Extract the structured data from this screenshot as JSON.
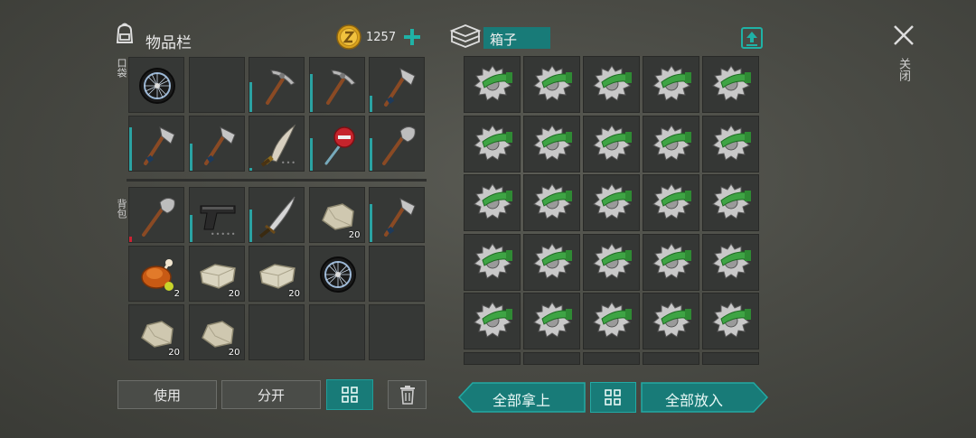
{
  "inventory": {
    "title": "物品栏",
    "coins": "1257",
    "pocket_label": "口袋",
    "backpack_label": "背包",
    "pocket_items": [
      {
        "icon": "wheel-icon"
      },
      {
        "icon": "empty"
      },
      {
        "icon": "pickaxe-icon",
        "durability": 0.55
      },
      {
        "icon": "pickaxe-icon",
        "durability": 0.7
      },
      {
        "icon": "hatchet-icon",
        "durability": 0.3
      },
      {
        "icon": "hatchet-icon",
        "durability": 0.8
      },
      {
        "icon": "hatchet-icon",
        "durability": 0.5
      },
      {
        "icon": "machete-icon",
        "durability": 0.0,
        "dots": "•••"
      },
      {
        "icon": "stop-sign-icon",
        "durability": 0.6
      },
      {
        "icon": "shovel-icon",
        "durability": 0.6
      }
    ],
    "backpack_items": [
      {
        "icon": "shovel-icon",
        "durability": 0.1,
        "red": true
      },
      {
        "icon": "pistol-icon",
        "durability": 0.5,
        "dots": "•••••"
      },
      {
        "icon": "sword-icon",
        "durability": 0.6
      },
      {
        "icon": "stone-icon",
        "count": "20"
      },
      {
        "icon": "hatchet-icon",
        "durability": 0.7
      },
      {
        "icon": "roast-chicken-icon",
        "count": "2"
      },
      {
        "icon": "stone-block-icon",
        "count": "20"
      },
      {
        "icon": "stone-block-icon",
        "count": "20"
      },
      {
        "icon": "wheel-icon"
      },
      {
        "icon": "empty"
      },
      {
        "icon": "stone-icon",
        "count": "20"
      },
      {
        "icon": "stone-icon",
        "count": "20"
      },
      {
        "icon": "empty"
      },
      {
        "icon": "empty"
      },
      {
        "icon": "empty"
      }
    ],
    "buttons": {
      "use": "使用",
      "split": "分开"
    }
  },
  "box": {
    "title": "箱子",
    "take_all": "全部拿上",
    "put_all": "全部放入",
    "item_icon": "saw-blade-icon",
    "visible_rows": 5,
    "cols": 5
  },
  "close": {
    "label": "关闭"
  },
  "colors": {
    "accent": "#187b78",
    "durability": "#2aa3a3"
  }
}
